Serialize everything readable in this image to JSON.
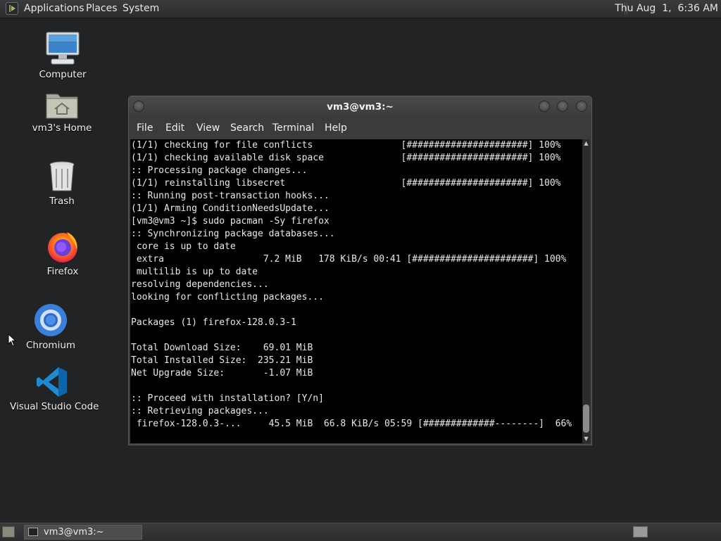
{
  "top_panel": {
    "menus": [
      "Applications",
      "Places",
      "System"
    ],
    "clock": "Thu Aug  1,  6:36 AM"
  },
  "desktop": {
    "icons": [
      {
        "label": "Computer",
        "icon": "computer-icon"
      },
      {
        "label": "vm3's Home",
        "icon": "home-folder-icon"
      },
      {
        "label": "Trash",
        "icon": "trash-icon"
      },
      {
        "label": "Firefox",
        "icon": "firefox-icon"
      },
      {
        "label": "Chromium",
        "icon": "chromium-icon"
      },
      {
        "label": "Visual Studio Code",
        "icon": "vscode-icon"
      }
    ]
  },
  "terminal": {
    "title": "vm3@vm3:~",
    "menu": [
      "File",
      "Edit",
      "View",
      "Search",
      "Terminal",
      "Help"
    ],
    "lines": [
      "(1/1) checking for file conflicts                [######################] 100%",
      "(1/1) checking available disk space              [######################] 100%",
      ":: Processing package changes...",
      "(1/1) reinstalling libsecret                     [######################] 100%",
      ":: Running post-transaction hooks...",
      "(1/1) Arming ConditionNeedsUpdate...",
      "[vm3@vm3 ~]$ sudo pacman -Sy firefox",
      ":: Synchronizing package databases...",
      " core is up to date",
      " extra                  7.2 MiB   178 KiB/s 00:41 [######################] 100%",
      " multilib is up to date",
      "resolving dependencies...",
      "looking for conflicting packages...",
      "",
      "Packages (1) firefox-128.0.3-1",
      "",
      "Total Download Size:    69.01 MiB",
      "Total Installed Size:  235.21 MiB",
      "Net Upgrade Size:       -1.07 MiB",
      "",
      ":: Proceed with installation? [Y/n]",
      ":: Retrieving packages...",
      " firefox-128.0.3-...     45.5 MiB  66.8 KiB/s 05:59 [#############--------]  66%"
    ]
  },
  "taskbar": {
    "task_label": "vm3@vm3:~"
  },
  "colors": {
    "desktop_bg": "#222324",
    "terminal_bg": "#000000",
    "terminal_fg": "#e8e8e8"
  }
}
